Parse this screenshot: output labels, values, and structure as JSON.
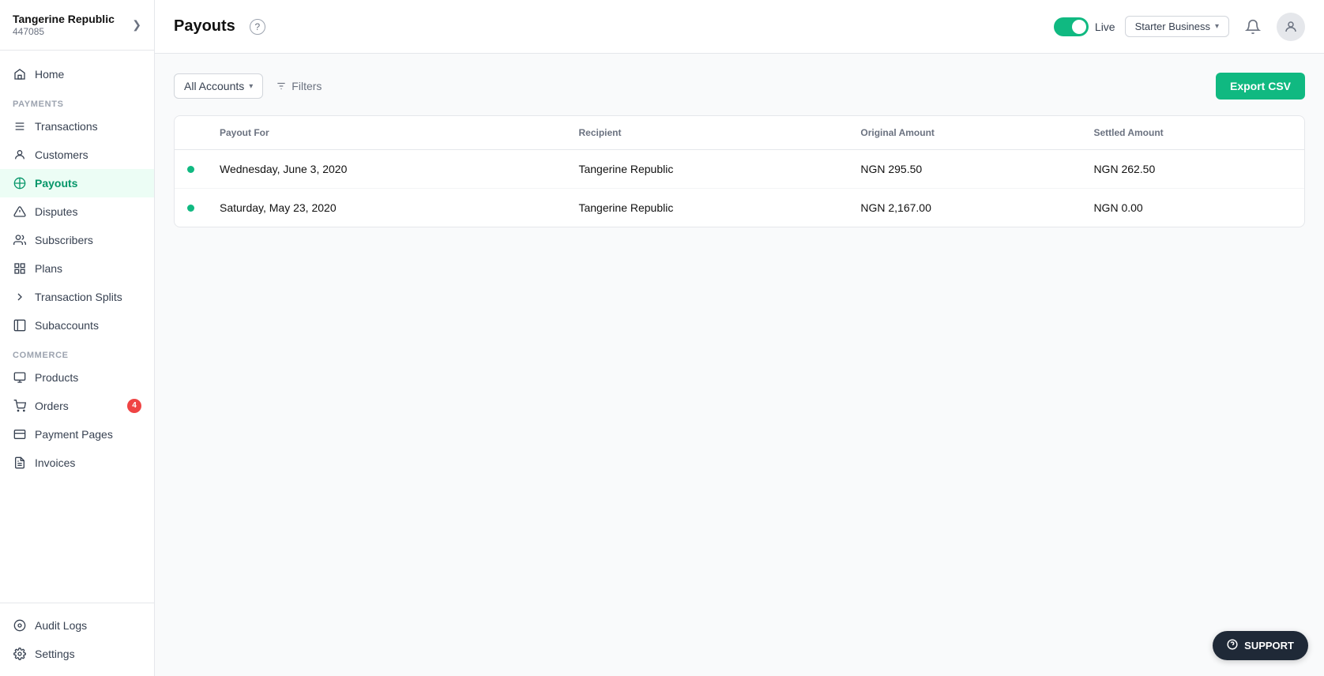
{
  "brand": {
    "name": "Tangerine Republic",
    "id": "447085",
    "chevron": "❯"
  },
  "sidebar": {
    "home_label": "Home",
    "payments_section": "PAYMENTS",
    "nav_items": [
      {
        "id": "transactions",
        "label": "Transactions",
        "icon": "≡",
        "active": false
      },
      {
        "id": "customers",
        "label": "Customers",
        "icon": "👤",
        "active": false
      },
      {
        "id": "payouts",
        "label": "Payouts",
        "icon": "↺",
        "active": true
      },
      {
        "id": "disputes",
        "label": "Disputes",
        "icon": "⚑",
        "active": false
      },
      {
        "id": "subscribers",
        "label": "Subscribers",
        "icon": "↻",
        "active": false
      },
      {
        "id": "plans",
        "label": "Plans",
        "icon": "◈",
        "active": false
      },
      {
        "id": "transaction-splits",
        "label": "Transaction Splits",
        "icon": "→",
        "active": false
      },
      {
        "id": "subaccounts",
        "label": "Subaccounts",
        "icon": "▣",
        "active": false
      }
    ],
    "commerce_section": "COMMERCE",
    "commerce_items": [
      {
        "id": "products",
        "label": "Products",
        "icon": "⊞",
        "active": false,
        "badge": null
      },
      {
        "id": "orders",
        "label": "Orders",
        "icon": "🛒",
        "active": false,
        "badge": "4"
      },
      {
        "id": "payment-pages",
        "label": "Payment Pages",
        "icon": "⊟",
        "active": false,
        "badge": null
      },
      {
        "id": "invoices",
        "label": "Invoices",
        "icon": "⊠",
        "active": false,
        "badge": null
      }
    ],
    "bottom_items": [
      {
        "id": "audit-logs",
        "label": "Audit Logs",
        "icon": "◉"
      },
      {
        "id": "settings",
        "label": "Settings",
        "icon": "⚙"
      }
    ]
  },
  "header": {
    "title": "Payouts",
    "help_tooltip": "?",
    "toggle_label": "Live",
    "plan_label": "Starter Business",
    "plan_chevron": "▾"
  },
  "toolbar": {
    "accounts_label": "All Accounts",
    "accounts_chevron": "▾",
    "filters_label": "Filters",
    "export_label": "Export CSV"
  },
  "table": {
    "columns": [
      "",
      "Payout For",
      "Recipient",
      "Original Amount",
      "Settled Amount"
    ],
    "rows": [
      {
        "status": "green",
        "payout_for": "Wednesday, June 3, 2020",
        "recipient": "Tangerine Republic",
        "original_amount": "NGN 295.50",
        "settled_amount": "NGN 262.50"
      },
      {
        "status": "green",
        "payout_for": "Saturday, May 23, 2020",
        "recipient": "Tangerine Republic",
        "original_amount": "NGN 2,167.00",
        "settled_amount": "NGN 0.00"
      }
    ]
  },
  "support": {
    "label": "SUPPORT",
    "icon": "?"
  }
}
